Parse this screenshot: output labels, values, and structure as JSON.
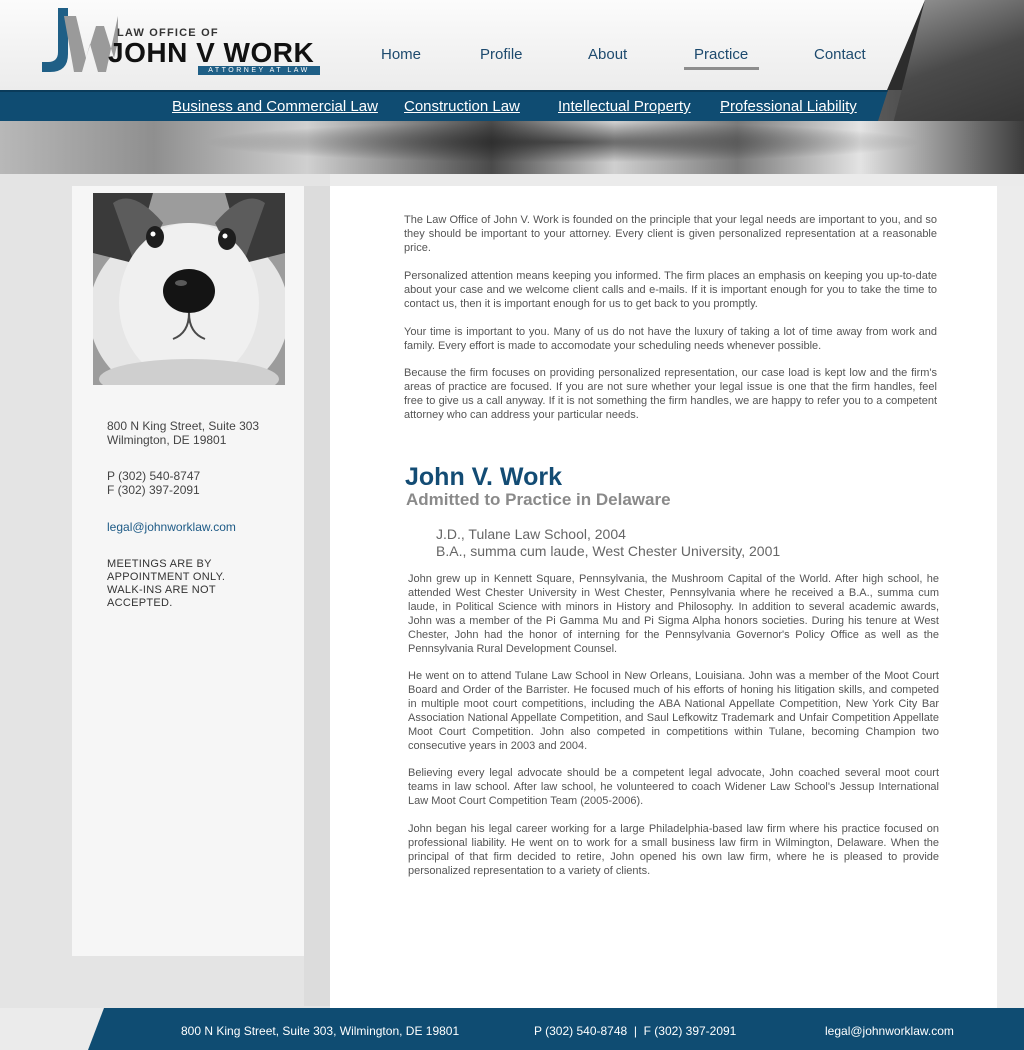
{
  "logo": {
    "monogram": "JW",
    "law_office_of": "LAW OFFICE OF",
    "name": "JOHN V WORK",
    "tagline": "ATTORNEY AT LAW"
  },
  "nav": {
    "items": [
      {
        "label": "Home"
      },
      {
        "label": "Profile"
      },
      {
        "label": "About"
      },
      {
        "label": "Practice",
        "active": true
      },
      {
        "label": "Contact"
      }
    ]
  },
  "subnav": {
    "items": [
      {
        "label": "Business and Commercial Law"
      },
      {
        "label": "Construction Law"
      },
      {
        "label": "Intellectual Property"
      },
      {
        "label": "Professional Liability"
      }
    ]
  },
  "sidebar": {
    "photo_alt": "dog-photo",
    "address_line1": "800 N King Street, Suite 303",
    "address_line2": "Wilmington, DE 19801",
    "phone": "P (302) 540-8747",
    "fax": "F (302) 397-2091",
    "email": "legal@johnworklaw.com",
    "note_line1": "MEETINGS ARE BY",
    "note_line2": "APPOINTMENT ONLY.",
    "note_line3": "WALK-INS ARE NOT",
    "note_line4": "ACCEPTED."
  },
  "main": {
    "intro": [
      "The Law Office of John V. Work is founded on the principle that your legal needs are important to you, and so they should be important to your attorney. Every client is given personalized representation at a reasonable price.",
      "Personalized attention means keeping you informed. The firm places an emphasis on keeping you up-to-date about your case and we welcome client calls and e-mails. If it is important enough for you to take the time to contact us, then it is important enough for us to get back to you promptly.",
      "Your time is important to you. Many of us do not have the luxury of taking a lot of time away from work and family. Every effort is made to accomodate your scheduling needs whenever possible.",
      "Because the firm focuses on providing personalized representation, our case load is kept low and the firm's areas of practice are focused. If you are not sure whether your legal issue is one that the firm handles, feel free to give us a call anyway. If it is not something the firm handles, we are happy to refer you to a competent attorney who can address your particular needs."
    ],
    "attorney_name": "John V. Work",
    "admitted": "Admitted to Practice in Delaware",
    "degrees": [
      "J.D., Tulane Law School, 2004",
      "B.A., summa cum laude, West Chester University, 2001"
    ],
    "bio": [
      "John grew up in Kennett Square, Pennsylvania, the Mushroom Capital of the World. After high school, he attended West Chester University in West Chester, Pennsylvania where he received a B.A., summa cum laude, in Political Science with minors in History and Philosophy.  In addition to several academic awards, John was a member of the Pi Gamma Mu and Pi Sigma Alpha honors societies.  During his tenure at West Chester, John had the honor of interning for the Pennsylvania Governor's Policy Office as well as the Pennsylvania Rural Development Counsel.",
      "He went on to attend Tulane Law School in New Orleans, Louisiana. John was a member of the Moot Court Board and Order of the Barrister. He focused much of his efforts of honing his litigation skills, and competed in multiple moot court competitions, including the ABA National Appellate Competition, New York City Bar Association National Appellate Competition, and Saul Lefkowitz Trademark and Unfair Competition Appellate Moot Court Competition. John also competed in competitions within Tulane, becoming Champion two consecutive years in 2003 and 2004.",
      "Believing every legal advocate should be a competent legal advocate, John coached several moot court teams in law school. After law school, he volunteered to coach Widener Law School's Jessup International Law Moot Court Competition Team (2005-2006).",
      "John began his legal career working for a large Philadelphia-based law firm where his practice focused on professional liability. He went on to work for a small business law firm in Wilmington, Delaware. When the principal of that firm decided to retire, John opened his own law firm, where he is pleased to provide personalized representation to a variety of clients."
    ]
  },
  "footer": {
    "address": "800 N King Street, Suite 303, Wilmington, DE 19801",
    "phones": "P (302) 540-8748  |  F (302) 397-2091",
    "email": "legal@johnworklaw.com"
  },
  "colors": {
    "brand_blue": "#0f4c72",
    "heading_blue": "#134c74",
    "nav_text": "#1d4a6e"
  }
}
